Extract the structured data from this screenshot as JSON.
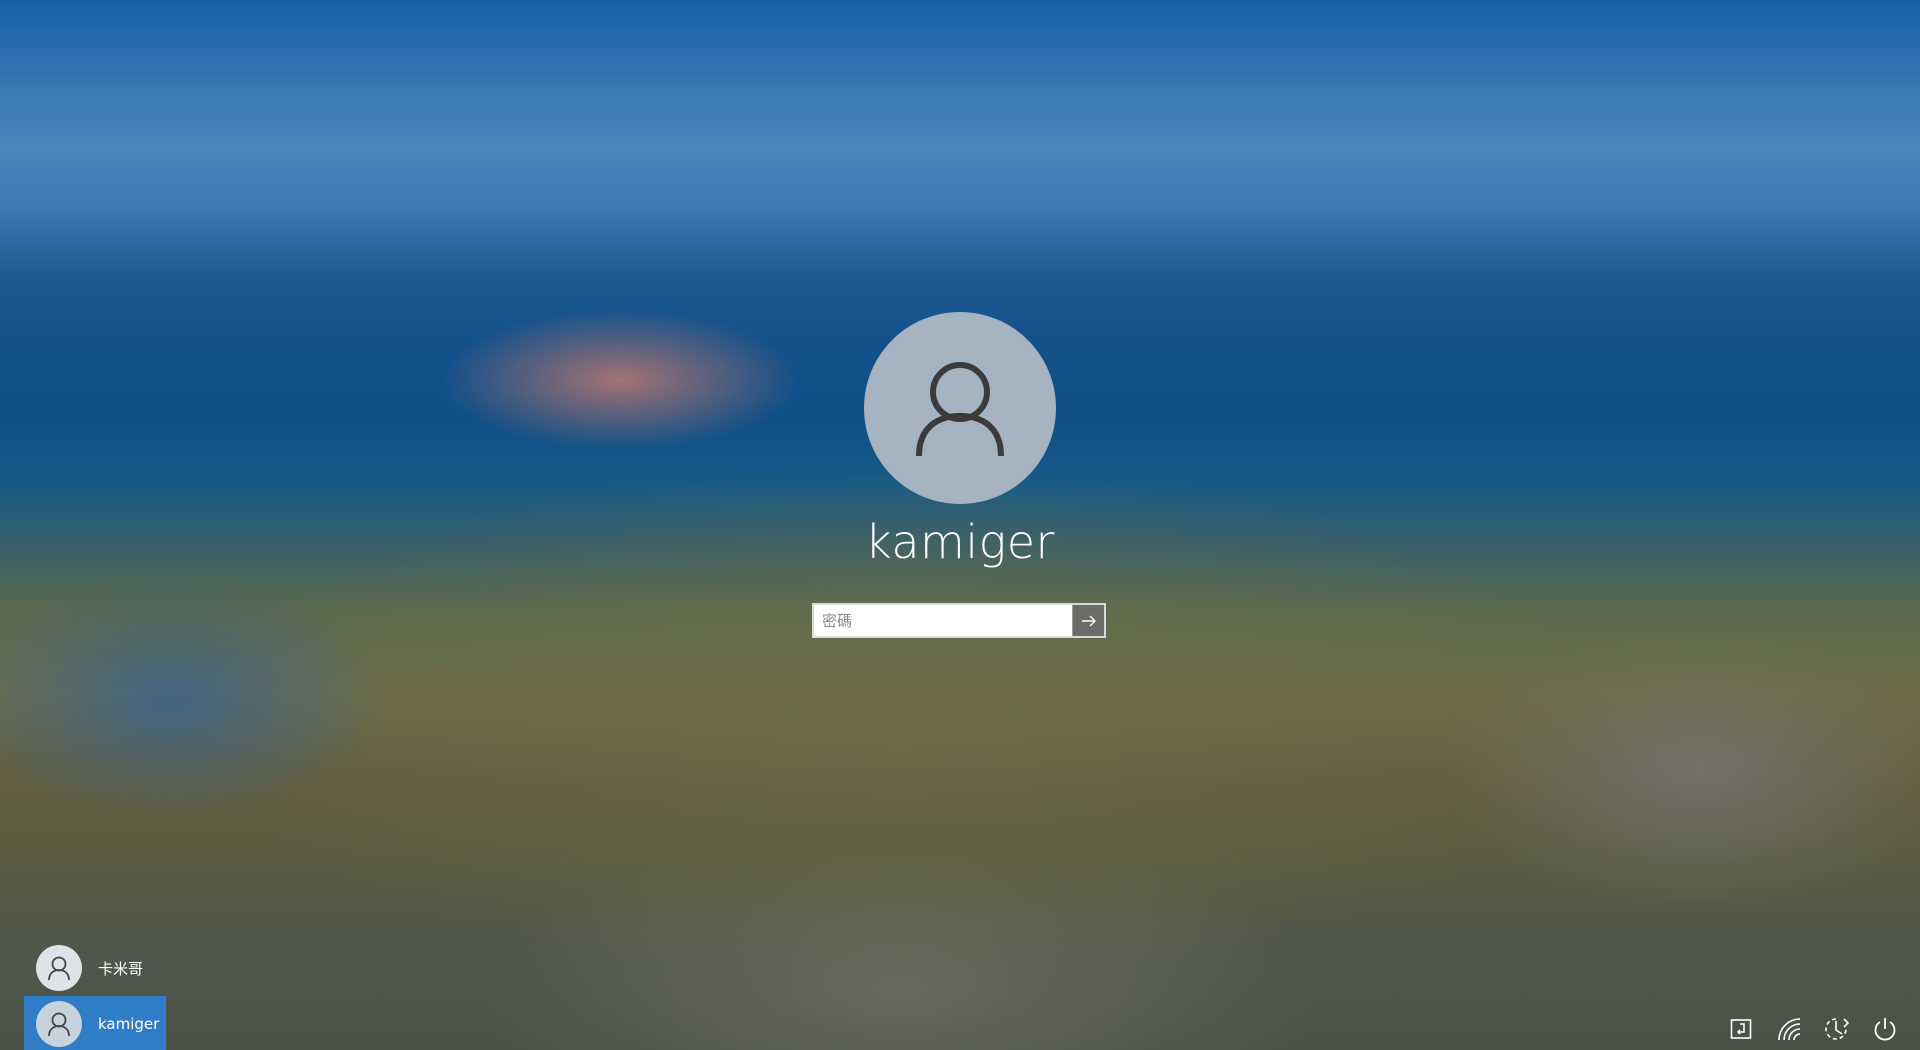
{
  "login": {
    "username": "kamiger",
    "password_placeholder": "密碼"
  },
  "users": [
    {
      "name": "卡米哥",
      "selected": false
    },
    {
      "name": "kamiger",
      "selected": true
    }
  ],
  "tray": {
    "icons": [
      "ease-of-access-icon",
      "network-icon",
      "accessibility-icon",
      "power-icon"
    ]
  },
  "colors": {
    "selected_user_bg": "#2f7dc6",
    "avatar_bg": "#a6b3c1",
    "submit_bg": "#6b6e68"
  }
}
